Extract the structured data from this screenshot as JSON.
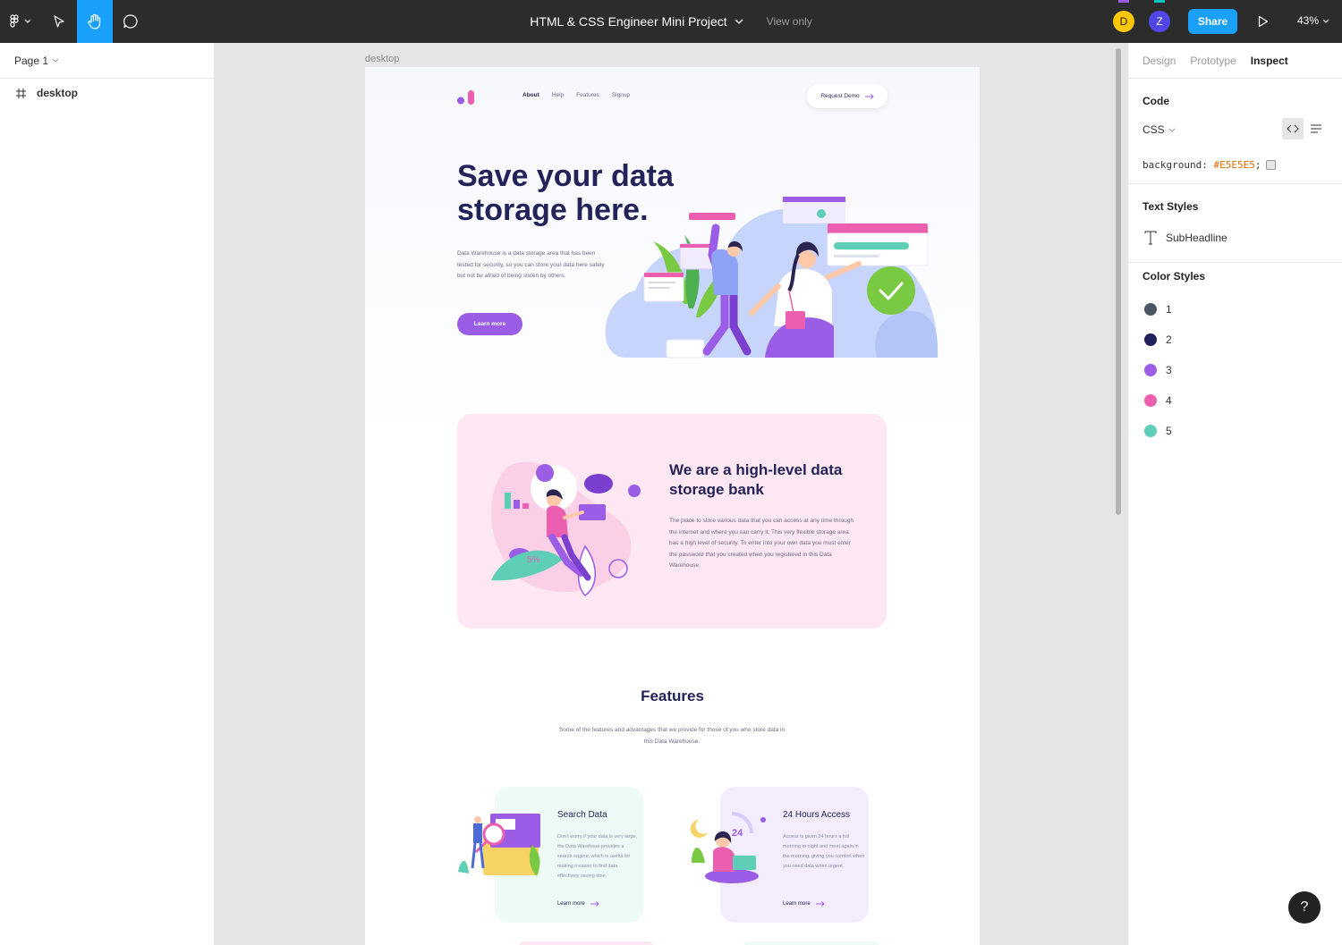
{
  "toolbar": {
    "doc_title": "HTML & CSS Engineer Mini Project",
    "view_mode": "View only",
    "avatars": [
      {
        "initial": "D",
        "color": "#ffc700"
      },
      {
        "initial": "Z",
        "color": "#4f46e5"
      }
    ],
    "share_label": "Share",
    "zoom": "43%",
    "accent": "#18a0fb"
  },
  "left_panel": {
    "page": "Page 1",
    "layers": [
      {
        "name": "desktop",
        "icon": "frame-icon"
      }
    ]
  },
  "right_panel": {
    "tabs": [
      "Design",
      "Prototype",
      "Inspect"
    ],
    "active_tab": "Inspect",
    "code": {
      "heading": "Code",
      "language": "CSS",
      "property": "background:",
      "value": "#E5E5E5",
      "terminator": ";"
    },
    "text_styles": {
      "heading": "Text Styles",
      "items": [
        "SubHeadline"
      ]
    },
    "color_styles": {
      "heading": "Color Styles",
      "items": [
        {
          "label": "1",
          "color": "#4b5563"
        },
        {
          "label": "2",
          "color": "#1f1f5a"
        },
        {
          "label": "3",
          "color": "#9b5de5"
        },
        {
          "label": "4",
          "color": "#ec5fb0"
        },
        {
          "label": "5",
          "color": "#5ecfb6"
        }
      ]
    }
  },
  "canvas": {
    "frame_label": "desktop",
    "nav": [
      "About",
      "Help",
      "Features",
      "Signup"
    ],
    "request_demo": "Request Demo",
    "hero": {
      "title": "Save your data storage here.",
      "description": "Data Warehouse is a data storage area that has been  tested for security, so you can store your data here  safely but not be afraid of being stolen by others.",
      "cta": "Learn more"
    },
    "bank": {
      "title": "We are a high-level data storage bank",
      "description": "The place to store various data that you can access at any time through the internet  and where you can carry it. This very flexible storage area has a high level of security. To enter into your own data you must enter the password that you created when you registered in this Data Warehouse."
    },
    "features": {
      "title": "Features",
      "description": "Some of the features and advantages that we provide for those of you who store data in this Data Warehouse.",
      "cards": [
        {
          "title": "Search Data",
          "description": "Don't worry if your data is very large, the Data Warehoue provides a search engine, which is useful for making it easier to find data effectively saving time.",
          "link": "Learn more"
        },
        {
          "title": "24 Hours Access",
          "description": "Access is given 24 hours a full morning to night and  meet again in the morning, giving you comfort when  you need data when urgent.",
          "link": "Learn more"
        }
      ]
    }
  }
}
